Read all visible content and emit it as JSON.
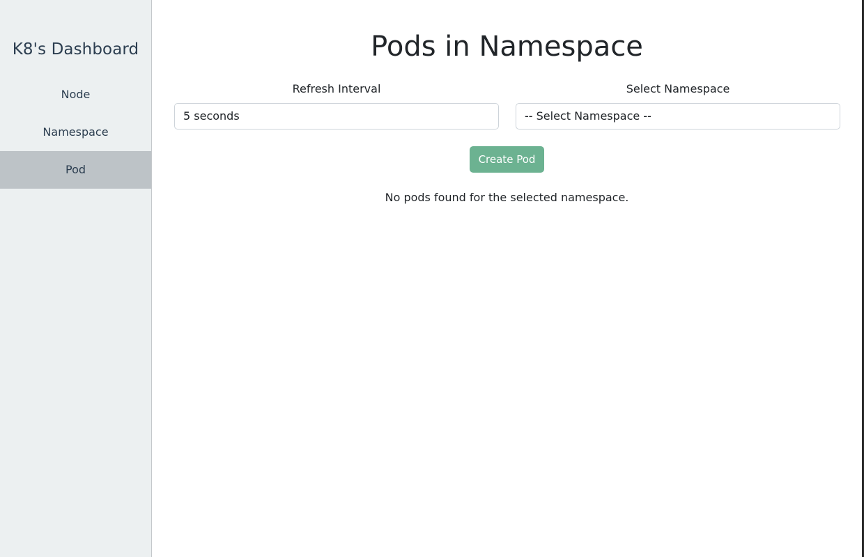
{
  "sidebar": {
    "brand": "K8's Dashboard",
    "items": [
      {
        "label": "Node",
        "active": false
      },
      {
        "label": "Namespace",
        "active": false
      },
      {
        "label": "Pod",
        "active": true
      }
    ],
    "active_color": "#bdc3c7",
    "background_color": "#ecf0f1"
  },
  "main": {
    "title": "Pods in Namespace",
    "refresh": {
      "label": "Refresh Interval",
      "value": "5 seconds"
    },
    "namespace": {
      "label": "Select Namespace",
      "value": "-- Select Namespace --"
    },
    "create_button": {
      "label": "Create Pod",
      "color": "#6cb291"
    },
    "empty_message": "No pods found for the selected namespace."
  }
}
